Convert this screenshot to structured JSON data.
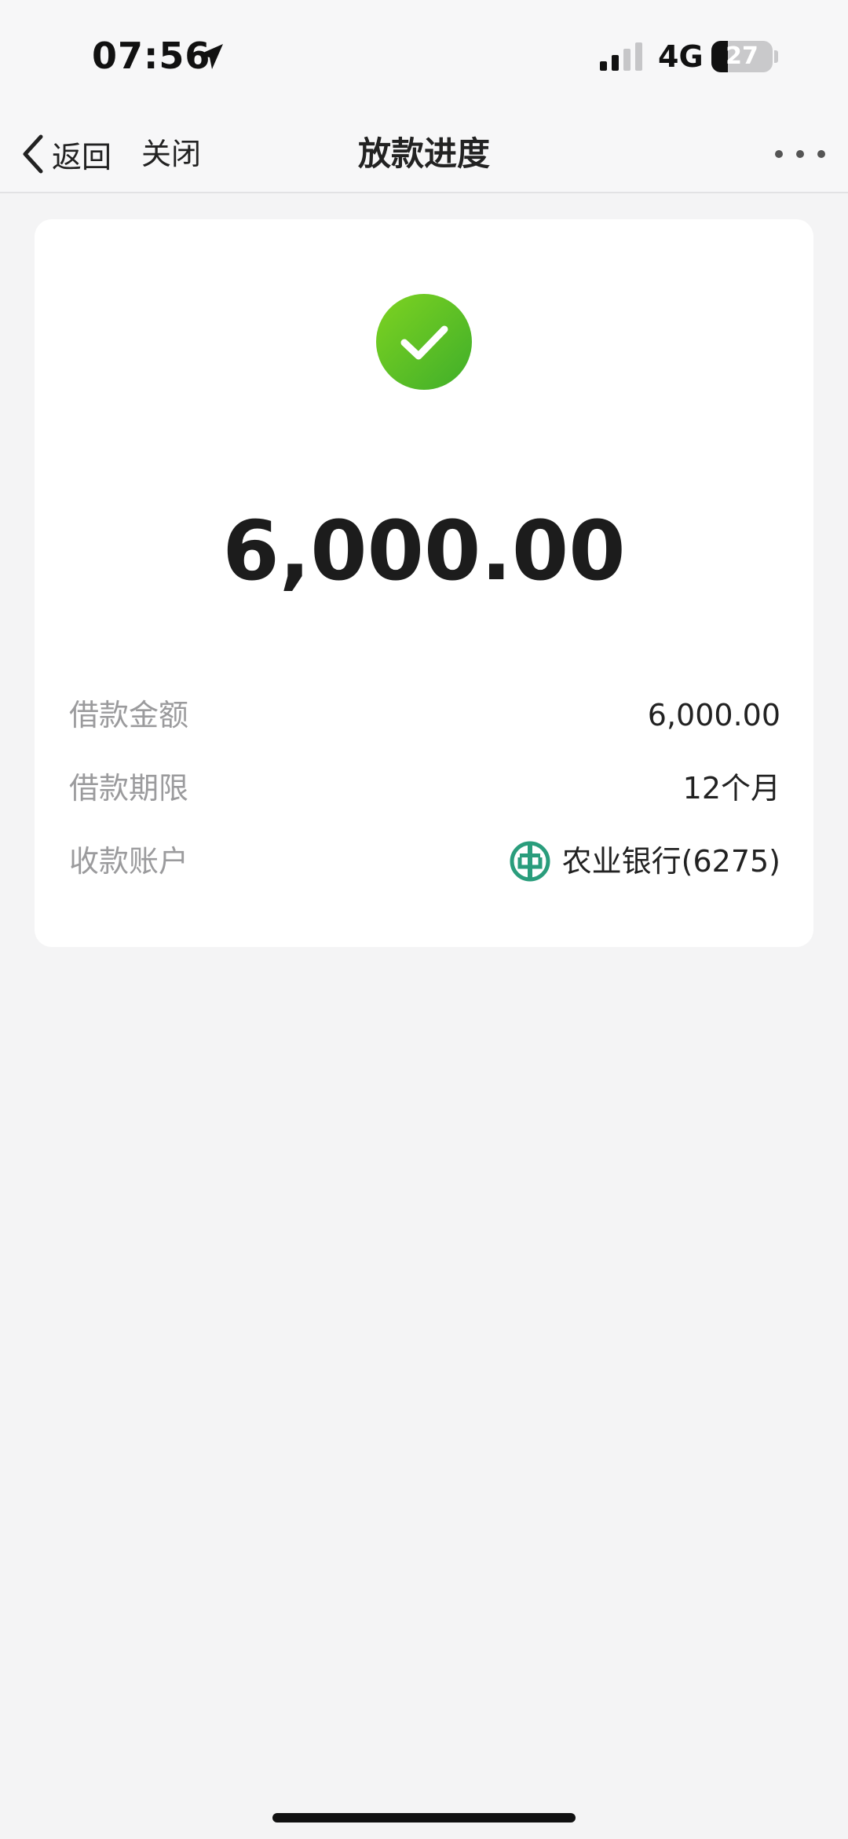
{
  "status_bar": {
    "time": "07:56",
    "network": "4G",
    "battery_level": "27",
    "battery_percent": 27,
    "location_icon": "location-arrow-icon",
    "signal_icon": "cellular-signal-icon"
  },
  "nav": {
    "back_label": "返回",
    "close_label": "关闭",
    "title": "放款进度",
    "more_icon": "more-dots-icon"
  },
  "card": {
    "status_icon": "success-check-icon",
    "status_color": "#4fbf26",
    "amount": "6,000.00",
    "details": [
      {
        "label": "借款金额",
        "value": "6,000.00"
      },
      {
        "label": "借款期限",
        "value": "12个月"
      },
      {
        "label": "收款账户",
        "value": "农业银行(6275)",
        "icon": "abc-bank-logo-icon"
      }
    ],
    "bank_logo_color": "#2a9d7c"
  }
}
